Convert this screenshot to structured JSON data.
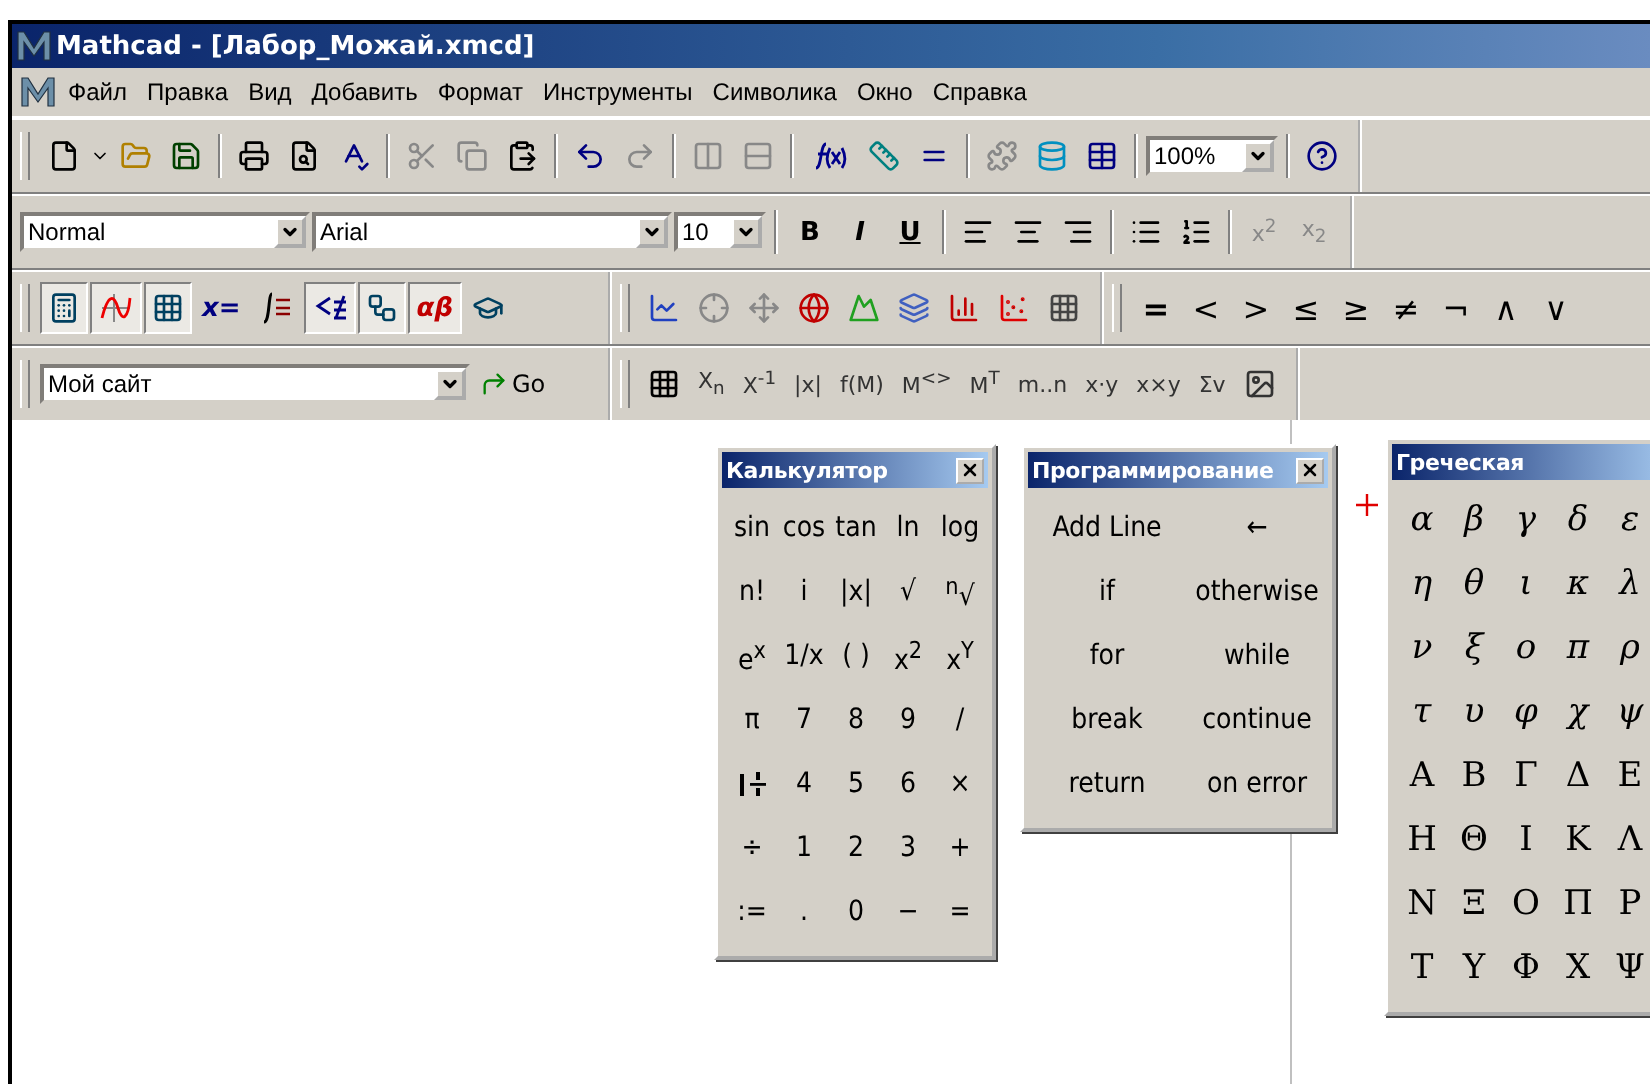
{
  "window": {
    "title": "Mathcad - [Лабор_Можай.xmcd]"
  },
  "menu": [
    "Файл",
    "Правка",
    "Вид",
    "Добавить",
    "Формат",
    "Инструменты",
    "Символика",
    "Окно",
    "Справка"
  ],
  "standard_toolbar": {
    "zoom": "100%"
  },
  "formatting_toolbar": {
    "style": "Normal",
    "font": "Arial",
    "size": "10",
    "buttons": [
      {
        "label": "B",
        "kind": "bold"
      },
      {
        "label": "I",
        "kind": "italic"
      },
      {
        "label": "U",
        "kind": "underline"
      }
    ],
    "script_buttons": [
      "x$^{2}$",
      "x$_{2}$"
    ]
  },
  "math_toolbar": [
    {
      "selected": true
    },
    {
      "selected": true
    },
    {
      "selected": true
    },
    {
      "label": "x=",
      "selected": false
    },
    {
      "selected": false
    },
    {
      "selected": true
    },
    {
      "selected": true
    },
    {
      "label": "αβ",
      "selected": true
    },
    {
      "selected": false
    }
  ],
  "boolean_toolbar": [
    "=",
    "<",
    ">",
    "≤",
    "≥",
    "≠",
    "¬",
    "∧",
    "∨"
  ],
  "web_toolbar": {
    "address": "Мой сайт",
    "go": "Go"
  },
  "matrix_toolbar": [
    "X$_{n}$",
    "X$^{-1}$",
    "|x|",
    "f(M)",
    "M$^{<>}$",
    "M$^{T}$",
    "m..n",
    "x·y",
    "x×y",
    "Σv"
  ],
  "calculator": {
    "title": "Калькулятор",
    "keys": [
      {
        "label": "sin"
      },
      {
        "label": "cos"
      },
      {
        "label": "tan"
      },
      {
        "label": "ln"
      },
      {
        "label": "log"
      },
      {
        "label": "n!"
      },
      {
        "label": "i"
      },
      {
        "label": "|x|"
      },
      {
        "label": "√"
      },
      {
        "label": "$^{n}$√"
      },
      {
        "label": "e$^{x}$"
      },
      {
        "label": "1/x"
      },
      {
        "label": "( )"
      },
      {
        "label": "x$^{2}$"
      },
      {
        "label": "x$^{Y}$"
      },
      {
        "label": "π"
      },
      {
        "label": "7"
      },
      {
        "label": "8"
      },
      {
        "label": "9"
      },
      {
        "label": "/"
      },
      {
        "kind": "icon"
      },
      {
        "label": "4"
      },
      {
        "label": "5"
      },
      {
        "label": "6"
      },
      {
        "label": "×"
      },
      {
        "label": "÷"
      },
      {
        "label": "1"
      },
      {
        "label": "2"
      },
      {
        "label": "3"
      },
      {
        "label": "+"
      },
      {
        "label": ":="
      },
      {
        "label": "."
      },
      {
        "label": "0"
      },
      {
        "label": "−"
      },
      {
        "label": "="
      }
    ]
  },
  "programming": {
    "title": "Программирование",
    "keys": [
      "Add Line",
      "←",
      "if",
      "otherwise",
      "for",
      "while",
      "break",
      "continue",
      "return",
      "on error"
    ]
  },
  "greek": {
    "title": "Греческая",
    "keys": [
      "α",
      "β",
      "γ",
      "δ",
      "ε",
      "η",
      "θ",
      "ι",
      "κ",
      "λ",
      "ν",
      "ξ",
      "ο",
      "π",
      "ρ",
      "τ",
      "υ",
      "φ",
      "χ",
      "ψ",
      "Α",
      "Β",
      "Γ",
      "Δ",
      "Ε",
      "Η",
      "Θ",
      "Ι",
      "Κ",
      "Λ",
      "Ν",
      "Ξ",
      "Ο",
      "Π",
      "Ρ",
      "Τ",
      "Υ",
      "Φ",
      "Χ",
      "Ψ"
    ]
  }
}
